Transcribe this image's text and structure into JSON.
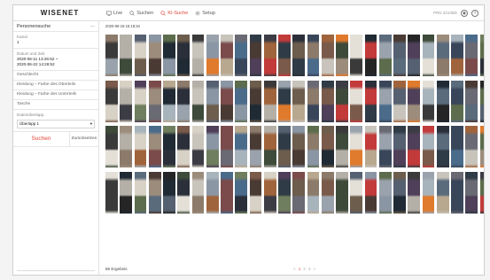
{
  "app": {
    "logo": "WISENET"
  },
  "nav": [
    {
      "label": "Live",
      "icon": "monitor-icon"
    },
    {
      "label": "Suchen",
      "icon": "search-icon"
    },
    {
      "label": "KI-Suche",
      "icon": "ai-search-icon",
      "active": true
    },
    {
      "label": "Setup",
      "icon": "gear-icon"
    }
  ],
  "topright": {
    "user": "PRN 3210BD",
    "help": "?"
  },
  "sidebar": {
    "title": "Personensuche",
    "menu_label": "···",
    "channel_label": "Kanal",
    "channel_value": "1",
    "datetime_label": "Datum und Zeit",
    "datetime_from": "2020-06-11 13:26:52 ~",
    "datetime_to": "2020-06-22 14:26:52",
    "filters": [
      "Geschlecht",
      "Kleidung – Farbe des Oberteils",
      "Kleidung – Farbe des Unterteils",
      "Tasche"
    ],
    "overlap_label": "Datenüberlapp.",
    "overlap_value": "Überlapp 1",
    "search_button": "Suchen",
    "reset_button": "Zurücksetzen"
  },
  "results": {
    "date_title": "2020-06-19 15:18:34",
    "count_text": "85 Ergebnis",
    "pager": {
      "prev": "<",
      "pages": [
        "1",
        "2",
        "3"
      ],
      "current": "1",
      "next": ">"
    },
    "palette": [
      "#3a3a3a",
      "#5a6b7c",
      "#8c7a6a",
      "#2b2f3a",
      "#6f7e5e",
      "#9aa3ad",
      "#4a3a34",
      "#b4b0a8",
      "#39465a",
      "#7a5a4a",
      "#c8c4bc",
      "#252525",
      "#556070",
      "#a0643c",
      "#d8d2c6",
      "#6a6a74",
      "#3e4a3a",
      "#8b96a4",
      "#e07a2c",
      "#4f3f58",
      "#2f3b46",
      "#9c8c7c",
      "#5c6c4c",
      "#e4e0d8",
      "#7b4b4b",
      "#3c3c44",
      "#a8b4bc",
      "#6d5d4d",
      "#1f2a34",
      "#b8a890",
      "#c23a3a",
      "#4b6b8b"
    ]
  }
}
